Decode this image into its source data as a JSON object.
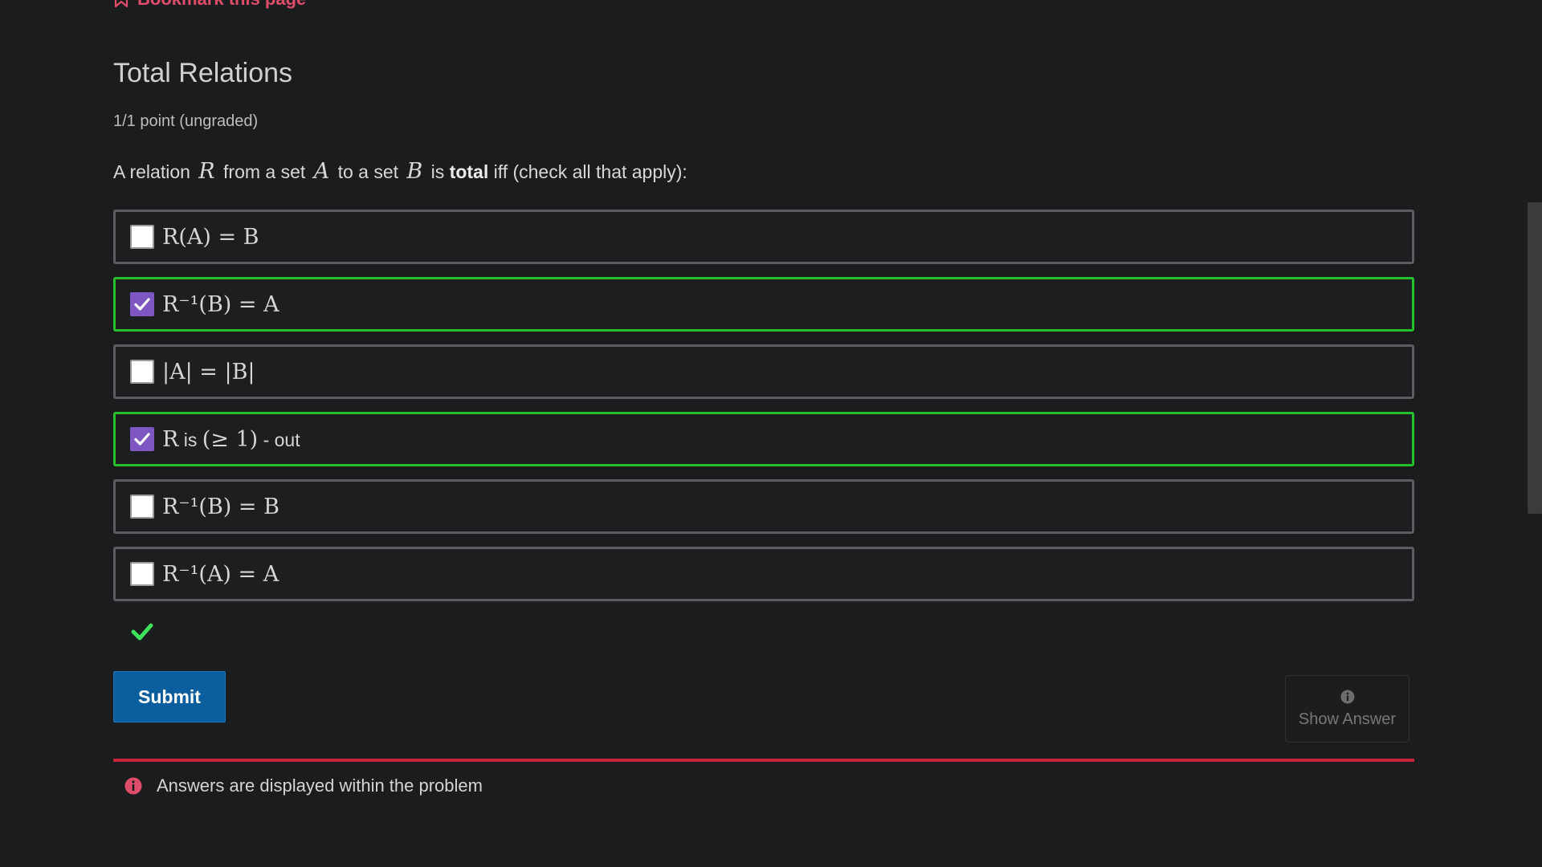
{
  "bookmark": {
    "label": "Bookmark this page"
  },
  "problem": {
    "title": "Total Relations",
    "points": "1/1 point (ungraded)",
    "prompt": {
      "p1": "A relation",
      "m1": "R",
      "p2": "from a set",
      "m2": "A",
      "p3": "to a set",
      "m3": "B",
      "p4": "is",
      "bold": "total",
      "p5": "iff (check all that apply):"
    }
  },
  "options": [
    {
      "text": "R(A) = B",
      "checked": false,
      "correct": false
    },
    {
      "text": "R⁻¹(B) = A",
      "checked": true,
      "correct": true
    },
    {
      "text": "|A| = |B|",
      "checked": false,
      "correct": false
    },
    {
      "text_math": "R",
      "text_plain": " is ",
      "text_math2": "(≥ 1)",
      "text_plain2": " - out",
      "checked": true,
      "correct": true
    },
    {
      "text": "R⁻¹(B) = B",
      "checked": false,
      "correct": false
    },
    {
      "text": "R⁻¹(A) = A",
      "checked": false,
      "correct": false
    }
  ],
  "actions": {
    "submit_label": "Submit",
    "show_answer_label": "Show Answer"
  },
  "notice": {
    "text": "Answers are displayed within the problem"
  },
  "colors": {
    "accent_red": "#e04d6b",
    "correct_green": "#23c22a",
    "checkbox_purple": "#7e57c2",
    "submit_blue": "#0b5e9e",
    "divider_red": "#c8233f"
  },
  "icons": {
    "bookmark": "bookmark-icon",
    "check": "checkmark-icon",
    "info": "info-circle-icon"
  }
}
